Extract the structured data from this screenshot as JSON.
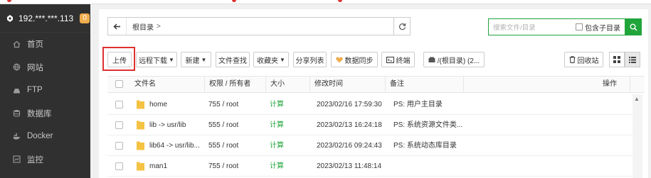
{
  "server": {
    "name": "192.***.***.113",
    "badge": "0"
  },
  "nav": [
    {
      "label": "首页",
      "icon": "home-icon"
    },
    {
      "label": "网站",
      "icon": "globe-icon"
    },
    {
      "label": "FTP",
      "icon": "ftp-icon"
    },
    {
      "label": "数据库",
      "icon": "database-icon"
    },
    {
      "label": "Docker",
      "icon": "docker-icon"
    },
    {
      "label": "监控",
      "icon": "monitor-icon"
    }
  ],
  "path": {
    "crumb": "根目录",
    "sep": ">"
  },
  "search": {
    "placeholder": "搜索文件/目录",
    "subdir_label": "包含子目录"
  },
  "toolbar": {
    "upload": "上传",
    "remote_download": "远程下载",
    "new": "新建",
    "file_search": "文件查找",
    "favorites": "收藏夹",
    "share_list": "分享列表",
    "data_sync": "数据同步",
    "terminal": "终端",
    "disk": "/(根目录) (2...",
    "recycle": "回收站"
  },
  "table": {
    "headers": [
      "文件名",
      "权限 / 所有者",
      "大小",
      "修改时间",
      "备注",
      "操作"
    ],
    "rows": [
      {
        "name": "home",
        "perm": "755 / root",
        "size": "计算",
        "time": "2023/02/16 17:59:30",
        "note": "PS: 用户主目录"
      },
      {
        "name": "lib -> usr/lib",
        "perm": "555 / root",
        "size": "计算",
        "time": "2023/02/13 16:24:18",
        "note": "PS: 系统资源文件类..."
      },
      {
        "name": "lib64 -> usr/lib...",
        "perm": "555 / root",
        "size": "计算",
        "time": "2023/02/16 09:24:43",
        "note": "PS:  系统动态库目录"
      },
      {
        "name": "man1",
        "perm": "755 / root",
        "size": "计算",
        "time": "2023/02/13 11:48:14",
        "note": ""
      }
    ]
  },
  "colors": {
    "accent": "#20a53a",
    "sidebar": "#303030",
    "highlight": "#e03030",
    "badge": "#f0ad4e"
  }
}
